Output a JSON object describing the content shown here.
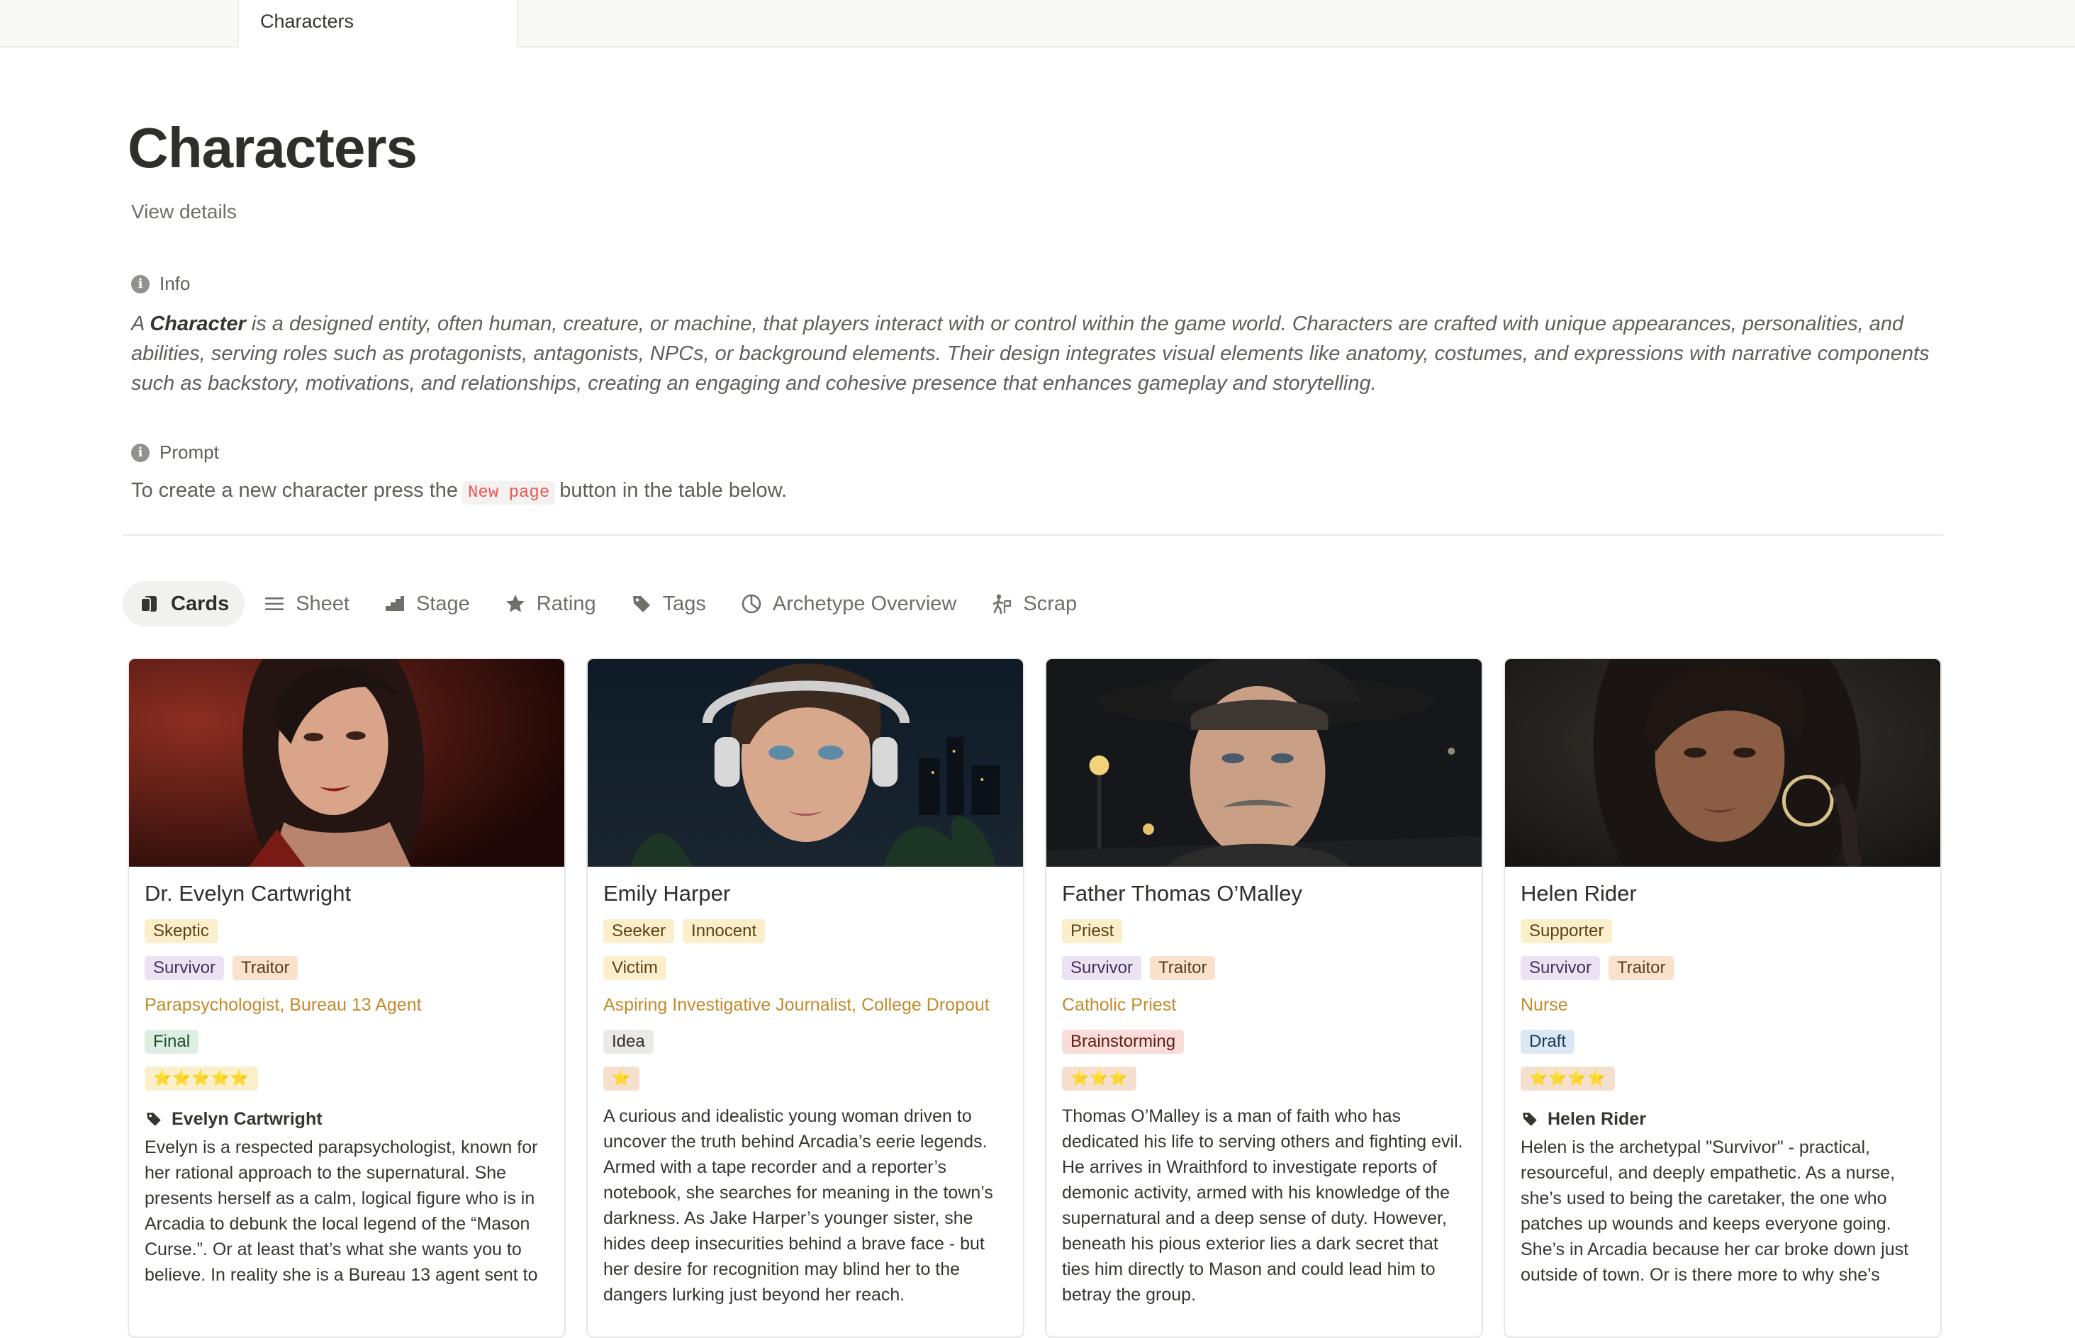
{
  "tab": {
    "label": "Characters"
  },
  "page": {
    "title": "Characters",
    "view_details": "View details"
  },
  "info": {
    "label": "Info",
    "lead": "A ",
    "term": "Character",
    "text": " is a designed entity, often human, creature, or machine, that players interact with or control within the game world. Characters are crafted with unique appearances, personalities, and abilities, serving roles such as protagonists, antagonists, NPCs, or background elements. Their design integrates visual elements like anatomy, costumes, and expressions with narrative components such as backstory, motivations, and relationships, creating an engaging and cohesive presence that enhances gameplay and storytelling."
  },
  "prompt": {
    "label": "Prompt",
    "before": "To create a new character press the",
    "code": "New page",
    "after": "button in the table below."
  },
  "views": [
    {
      "label": "Cards",
      "icon": "cards-icon",
      "active": true
    },
    {
      "label": "Sheet",
      "icon": "list-icon"
    },
    {
      "label": "Stage",
      "icon": "stage-icon"
    },
    {
      "label": "Rating",
      "icon": "star-icon"
    },
    {
      "label": "Tags",
      "icon": "tag-icon"
    },
    {
      "label": "Archetype Overview",
      "icon": "pie-chart-icon"
    },
    {
      "label": "Scrap",
      "icon": "figure-icon"
    }
  ],
  "cards": [
    {
      "name": "Dr. Evelyn Cartwright",
      "archetypes": [
        "Skeptic"
      ],
      "roles": [
        "Survivor",
        "Traitor"
      ],
      "occupation": "Parapsychologist, Bureau 13 Agent",
      "status": "Final",
      "rating": "⭐⭐⭐⭐⭐",
      "relation": "Evelyn Cartwright",
      "description": "Evelyn is a respected parapsychologist, known for her rational approach to the supernatural. She presents herself as a calm, logical figure who is in Arcadia to debunk the local legend of the “Mason Curse.”. Or at least that’s what she wants you to believe. In reality she is a Bureau 13 agent sent to"
    },
    {
      "name": "Emily Harper",
      "archetypes": [
        "Seeker",
        "Innocent"
      ],
      "roles": [
        "Victim"
      ],
      "occupation": "Aspiring Investigative Journalist, College Dropout",
      "status": "Idea",
      "rating": "⭐",
      "relation": "",
      "description": "A curious and idealistic young woman driven to uncover the truth behind Arcadia’s eerie legends. Armed with a tape recorder and a reporter’s notebook, she searches for meaning in the town’s darkness. As Jake Harper’s younger sister, she hides deep insecurities behind a brave face - but her desire for recognition may blind her to the dangers lurking just beyond her reach."
    },
    {
      "name": "Father Thomas O’Malley",
      "archetypes": [
        "Priest"
      ],
      "roles": [
        "Survivor",
        "Traitor"
      ],
      "occupation": "Catholic Priest",
      "status": "Brainstorming",
      "rating": "⭐⭐⭐",
      "relation": "",
      "description": "Thomas O’Malley is a man of faith who has dedicated his life to serving others and fighting evil. He arrives in Wraithford to investigate reports of demonic activity, armed with his knowledge of the supernatural and a deep sense of duty. However, beneath his pious exterior lies a dark secret that ties him directly to Mason and could lead him to betray the group."
    },
    {
      "name": "Helen Rider",
      "archetypes": [
        "Supporter"
      ],
      "roles": [
        "Survivor",
        "Traitor"
      ],
      "occupation": "Nurse",
      "status": "Draft",
      "rating": "⭐⭐⭐⭐",
      "relation": "Helen Rider",
      "description": "Helen is the archetypal \"Survivor\" - practical, resourceful, and deeply empathetic. As a nurse, she’s used to being the caretaker, the one who patches up wounds and keeps everyone going. She’s in Arcadia because her car broke down just outside of town. Or is there more to why she’s"
    }
  ]
}
